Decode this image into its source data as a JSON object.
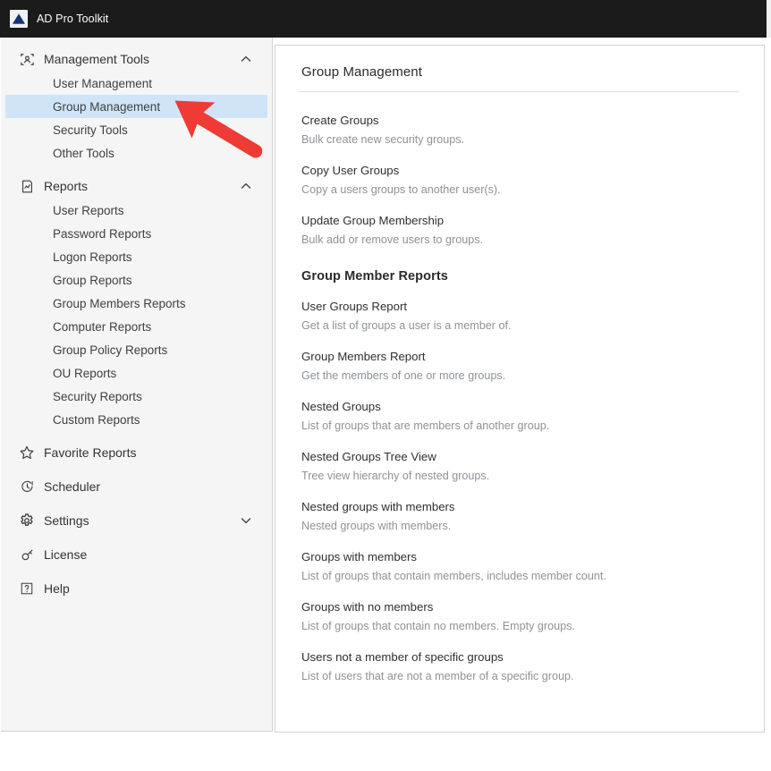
{
  "window": {
    "app_title": "AD Pro Toolkit",
    "logo_icon": "ad-pro-triangle-logo",
    "titlebar_color": "#1b1b1b",
    "selection_color": "#cfe5f7",
    "annotation_arrow_color": "#ee3b35"
  },
  "sidebar": {
    "groups": [
      {
        "label": "Management Tools",
        "icon": "people-frame-icon",
        "chevron": "chevron-up-icon",
        "expanded": true,
        "items": [
          {
            "label": "User Management",
            "selected": false
          },
          {
            "label": "Group Management",
            "selected": true
          },
          {
            "label": "Security Tools",
            "selected": false
          },
          {
            "label": "Other Tools",
            "selected": false
          }
        ]
      },
      {
        "label": "Reports",
        "icon": "report-chart-icon",
        "chevron": "chevron-up-icon",
        "expanded": true,
        "items": [
          {
            "label": "User Reports",
            "selected": false
          },
          {
            "label": "Password Reports",
            "selected": false
          },
          {
            "label": "Logon Reports",
            "selected": false
          },
          {
            "label": "Group Reports",
            "selected": false
          },
          {
            "label": "Group Members Reports",
            "selected": false
          },
          {
            "label": "Computer Reports",
            "selected": false
          },
          {
            "label": "Group Policy Reports",
            "selected": false
          },
          {
            "label": "OU Reports",
            "selected": false
          },
          {
            "label": "Security Reports",
            "selected": false
          },
          {
            "label": "Custom Reports",
            "selected": false
          }
        ]
      }
    ],
    "standalone": [
      {
        "label": "Favorite Reports",
        "icon": "star-icon",
        "chevron": null
      },
      {
        "label": "Scheduler",
        "icon": "clock-icon",
        "chevron": null
      },
      {
        "label": "Settings",
        "icon": "gear-icon",
        "chevron": "chevron-down-icon"
      },
      {
        "label": "License",
        "icon": "key-icon",
        "chevron": null
      },
      {
        "label": "Help",
        "icon": "question-box-icon",
        "chevron": null
      }
    ]
  },
  "main": {
    "page_title": "Group Management",
    "tools": [
      {
        "title": "Create Groups",
        "desc": "Bulk create new security groups."
      },
      {
        "title": "Copy User Groups",
        "desc": "Copy a users groups to another user(s)."
      },
      {
        "title": "Update Group Membership",
        "desc": "Bulk add or remove users to groups."
      }
    ],
    "reports_heading": "Group Member Reports",
    "reports": [
      {
        "title": "User Groups Report",
        "desc": "Get a list of groups a user is a member of."
      },
      {
        "title": "Group Members Report",
        "desc": "Get the members of one or more groups."
      },
      {
        "title": "Nested Groups",
        "desc": "List of groups that are members of another group."
      },
      {
        "title": "Nested Groups Tree View",
        "desc": "Tree view hierarchy of nested groups."
      },
      {
        "title": "Nested groups with members",
        "desc": "Nested groups with members."
      },
      {
        "title": "Groups with members",
        "desc": "List of groups that contain members, includes member count."
      },
      {
        "title": "Groups with no members",
        "desc": "List of groups that contain no members. Empty groups."
      },
      {
        "title": "Users not a member of specific groups",
        "desc": "List of users that are not a member of a specific group."
      }
    ]
  }
}
